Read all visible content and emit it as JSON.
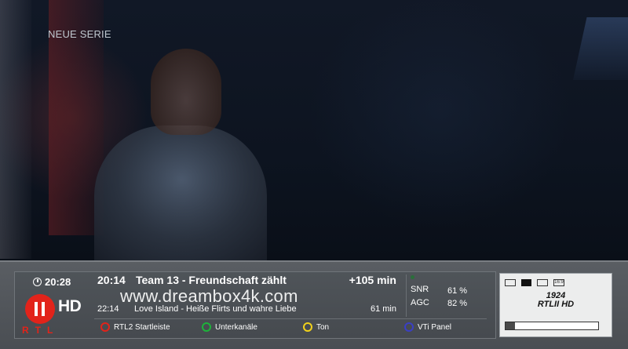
{
  "video": {
    "series_tag": "NEUE SERIE"
  },
  "infobar": {
    "clock": "20:28",
    "channel_logo": {
      "text_hd": "HD",
      "text_brand": "RTL"
    },
    "now": {
      "time": "20:14",
      "title": "Team 13 - Freundschaft zählt",
      "remaining": "+105 min"
    },
    "watermark": "www.dreambox4k.com",
    "next": {
      "time": "22:14",
      "title": "Love Island - Heiße Flirts und wahre Liebe",
      "duration": "61 min"
    },
    "signal": {
      "snr_label": "SNR",
      "snr_value": "61 %",
      "agc_label": "AGC",
      "agc_value": "82 %"
    },
    "color_keys": [
      {
        "color": "#e2231a",
        "label": "RTL2 Startleiste"
      },
      {
        "color": "#1db33a",
        "label": "Unterkanäle"
      },
      {
        "color": "#f2d21b",
        "label": "Ton"
      },
      {
        "color": "#3a3fc4",
        "label": "VTi Panel"
      }
    ],
    "channel_panel": {
      "icons": [
        "hdmi-icon",
        "screen-icon",
        "teletext-icon",
        "aspect-16-9-icon",
        "dolby-icon"
      ],
      "aspect_text": "16:9",
      "channel_number": "1924",
      "channel_name": "RTLII HD",
      "progress_fraction": 0.1
    }
  }
}
